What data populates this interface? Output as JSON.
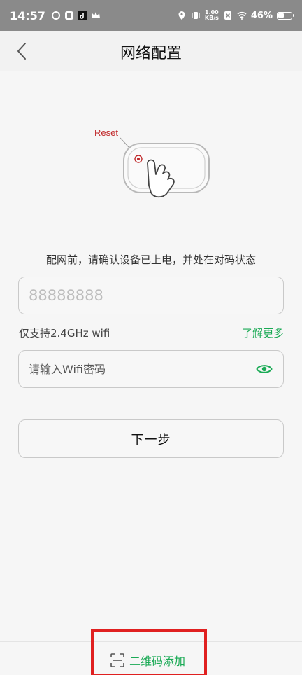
{
  "status_bar": {
    "time": "14:57",
    "net_speed_value": "1.00",
    "net_speed_unit": "KB/s",
    "battery": "46%"
  },
  "header": {
    "title": "网络配置",
    "back_icon": "chevron-left-icon"
  },
  "illustration": {
    "reset_label": "Reset"
  },
  "form": {
    "hint": "配网前，请确认设备已上电，并处在对码状态",
    "ssid_placeholder": "88888888",
    "support_note": "仅支持2.4GHz wifi",
    "learn_more": "了解更多",
    "password_placeholder": "请输入Wifi密码",
    "next_button": "下一步"
  },
  "bottom": {
    "qr_add_label": "二维码添加",
    "qr_icon": "scan-icon"
  },
  "colors": {
    "accent": "#1aaa55",
    "highlight": "#e02020",
    "status_bar": "#8a8a8a"
  }
}
